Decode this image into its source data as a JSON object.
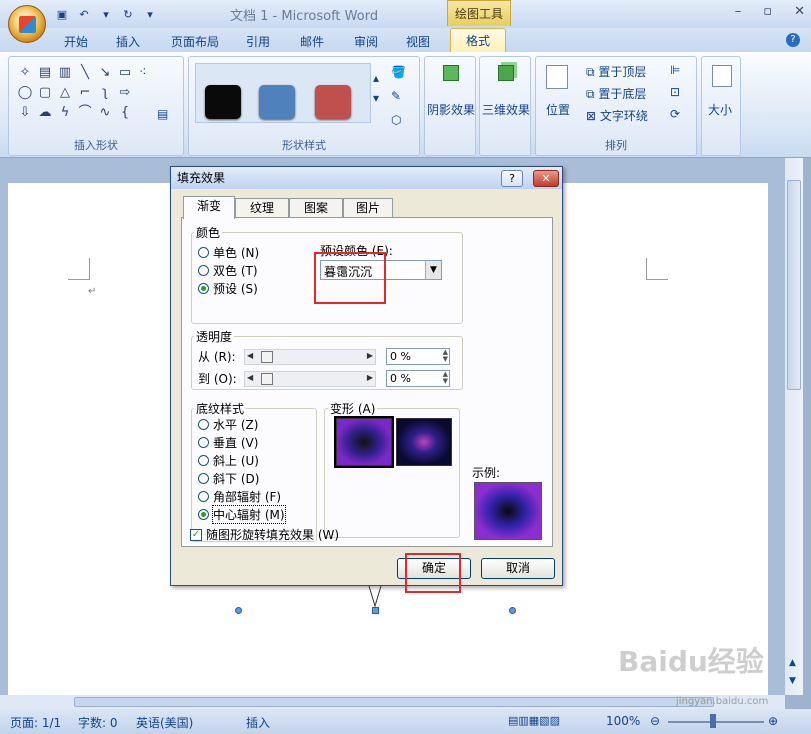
{
  "window": {
    "title": "文档 1 - Microsoft Word",
    "context_tool": "绘图工具",
    "controls": [
      "–",
      "▫",
      "✕"
    ]
  },
  "ribbon_tabs": [
    "开始",
    "插入",
    "页面布局",
    "引用",
    "邮件",
    "审阅",
    "视图",
    "格式"
  ],
  "ribbon": {
    "insert_shapes_label": "插入形状",
    "shape_styles_label": "形状样式",
    "shadow_effect_label": "阴影效果",
    "effect_3d_label": "三维效果",
    "position_label": "位置",
    "arrange_label": "排列",
    "bring_front_label": "置于顶层",
    "send_back_label": "置于底层",
    "text_wrap_label": "文字环绕",
    "size_label": "大小",
    "swatch_colors": [
      "#0a0a0a",
      "#4f81bd",
      "#c0504d"
    ]
  },
  "dialog": {
    "title": "填充效果",
    "help": "?",
    "close": "✕",
    "tabs": [
      "渐变",
      "纹理",
      "图案",
      "图片"
    ],
    "colors_legend": "颜色",
    "color_options": [
      "单色 (N)",
      "双色 (T)",
      "预设 (S)"
    ],
    "color_selected": 2,
    "preset_label": "预设颜色 (E):",
    "preset_value": "暮霭沉沉",
    "transparency_legend": "透明度",
    "from_label": "从 (R):",
    "to_label": "到 (O):",
    "from_value": "0 %",
    "to_value": "0 %",
    "from_fraction": 0.0,
    "to_fraction": 0.0,
    "shading_legend": "底纹样式",
    "shading_options": [
      "水平 (Z)",
      "垂直 (V)",
      "斜上 (U)",
      "斜下 (D)",
      "角部辐射 (F)",
      "中心辐射 (M)"
    ],
    "shading_selected": 5,
    "variants_legend": "变形 (A)",
    "sample_label": "示例:",
    "rotate_label": "随图形旋转填充效果 (W)",
    "rotate_checked": true,
    "ok_label": "确定",
    "cancel_label": "取消"
  },
  "statusbar": {
    "page": "页面: 1/1",
    "words": "字数: 0",
    "language": "英语(美国)",
    "mode": "插入",
    "zoom": "100%"
  },
  "watermark": "jingyan.baidu.com"
}
